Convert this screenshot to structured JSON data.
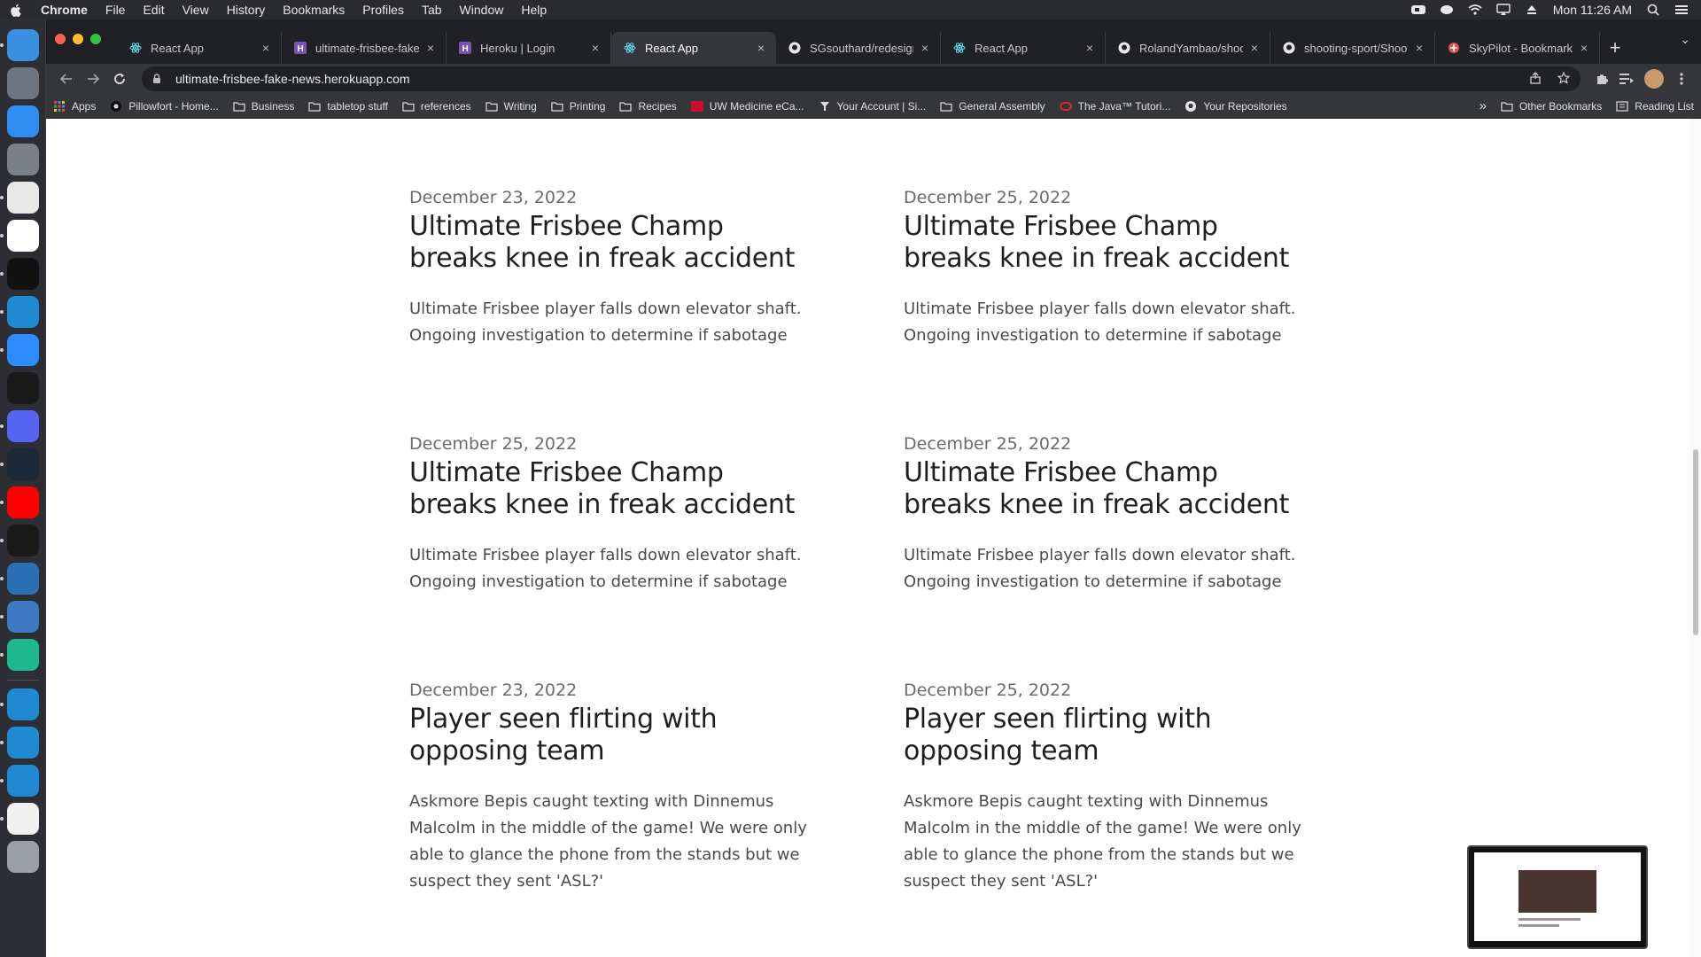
{
  "menubar": {
    "app_name": "Chrome",
    "items": [
      "File",
      "Edit",
      "View",
      "History",
      "Bookmarks",
      "Profiles",
      "Tab",
      "Window",
      "Help"
    ],
    "clock": "Mon 11:26 AM"
  },
  "tabs": [
    {
      "label": "React App",
      "icon": "react-icon"
    },
    {
      "label": "ultimate-frisbee-fake",
      "icon": "heroku-icon"
    },
    {
      "label": "Heroku | Login",
      "icon": "heroku-icon"
    },
    {
      "label": "React App",
      "icon": "react-icon",
      "active": true
    },
    {
      "label": "SGsouthard/redesign",
      "icon": "github-icon"
    },
    {
      "label": "React App",
      "icon": "react-icon"
    },
    {
      "label": "RolandYambao/shoot",
      "icon": "github-icon"
    },
    {
      "label": "shooting-sport/Shoot",
      "icon": "github-icon"
    },
    {
      "label": "SkyPilot - Bookmarks",
      "icon": "skypilot-icon"
    }
  ],
  "address_bar": {
    "url": "ultimate-frisbee-fake-news.herokuapp.com"
  },
  "bookmarks": [
    {
      "label": "Apps",
      "icon": "apps-grid-icon"
    },
    {
      "label": "Pillowfort - Home...",
      "icon": "pillowfort-icon"
    },
    {
      "label": "Business",
      "icon": "folder-icon"
    },
    {
      "label": "tabletop stuff",
      "icon": "folder-icon"
    },
    {
      "label": "references",
      "icon": "folder-icon"
    },
    {
      "label": "Writing",
      "icon": "folder-icon"
    },
    {
      "label": "Printing",
      "icon": "folder-icon"
    },
    {
      "label": "Recipes",
      "icon": "folder-icon"
    },
    {
      "label": "UW Medicine eCa...",
      "icon": "uw-icon"
    },
    {
      "label": "Your Account | Si...",
      "icon": "account-icon"
    },
    {
      "label": "General Assembly",
      "icon": "folder-icon"
    },
    {
      "label": "The Java™ Tutori...",
      "icon": "oracle-icon"
    },
    {
      "label": "Your Repositories",
      "icon": "github-icon"
    }
  ],
  "bookmarks_right": {
    "overflow": "»",
    "other": "Other Bookmarks",
    "reading_list": "Reading List"
  },
  "articles": [
    {
      "date": "December 23, 2022",
      "title": "Ultimate Frisbee Champ breaks knee in freak accident",
      "body": "Ultimate Frisbee player falls down elevator shaft. Ongoing investigation to determine if sabotage"
    },
    {
      "date": "December 25, 2022",
      "title": "Ultimate Frisbee Champ breaks knee in freak accident",
      "body": "Ultimate Frisbee player falls down elevator shaft. Ongoing investigation to determine if sabotage"
    },
    {
      "date": "December 25, 2022",
      "title": "Ultimate Frisbee Champ breaks knee in freak accident",
      "body": "Ultimate Frisbee player falls down elevator shaft. Ongoing investigation to determine if sabotage"
    },
    {
      "date": "December 25, 2022",
      "title": "Ultimate Frisbee Champ breaks knee in freak accident",
      "body": "Ultimate Frisbee player falls down elevator shaft. Ongoing investigation to determine if sabotage"
    },
    {
      "date": "December 23, 2022",
      "title": "Player seen flirting with opposing team",
      "body": "Askmore Bepis caught texting with Dinnemus Malcolm in the middle of the game! We were only able to glance the phone from the stands but we suspect they sent 'ASL?'"
    },
    {
      "date": "December 25, 2022",
      "title": "Player seen flirting with opposing team",
      "body": "Askmore Bepis caught texting with Dinnemus Malcolm in the middle of the game! We were only able to glance the phone from the stands but we suspect they sent 'ASL?'"
    }
  ],
  "dock": [
    {
      "name": "finder-icon",
      "color": "#3b8fe0"
    },
    {
      "name": "launchpad-icon",
      "color": "#6f7580"
    },
    {
      "name": "app-store-icon",
      "color": "#2f8cf0"
    },
    {
      "name": "system-preferences-icon",
      "color": "#7b7f86"
    },
    {
      "name": "chrome-icon",
      "color": "#e8e8e8"
    },
    {
      "name": "slack-icon",
      "color": "#ffffff"
    },
    {
      "name": "terminal-icon",
      "color": "#111111"
    },
    {
      "name": "vscode-icon",
      "color": "#1f8ad2"
    },
    {
      "name": "zoom-icon",
      "color": "#2d8cff"
    },
    {
      "name": "compass-icon",
      "color": "#1a1a1a"
    },
    {
      "name": "discord-icon",
      "color": "#5865f2"
    },
    {
      "name": "steam-icon",
      "color": "#1b2838"
    },
    {
      "name": "youtube-music-icon",
      "color": "#ff0000"
    },
    {
      "name": "screen-capture-icon",
      "color": "#1a1a1a"
    },
    {
      "name": "tableplus-icon",
      "color": "#2b6fb4"
    },
    {
      "name": "postgres-elephant-icon",
      "color": "#3d78c2"
    },
    {
      "name": "robot-app-icon",
      "color": "#1fb98f"
    },
    {
      "name": "vscode-icon",
      "color": "#1f8ad2"
    },
    {
      "name": "vscode-icon",
      "color": "#1f8ad2"
    },
    {
      "name": "vscode-icon",
      "color": "#1f8ad2"
    },
    {
      "name": "bulma-doc-icon",
      "color": "#f0f0f0"
    },
    {
      "name": "trash-icon",
      "color": "#9a9ea5"
    }
  ]
}
